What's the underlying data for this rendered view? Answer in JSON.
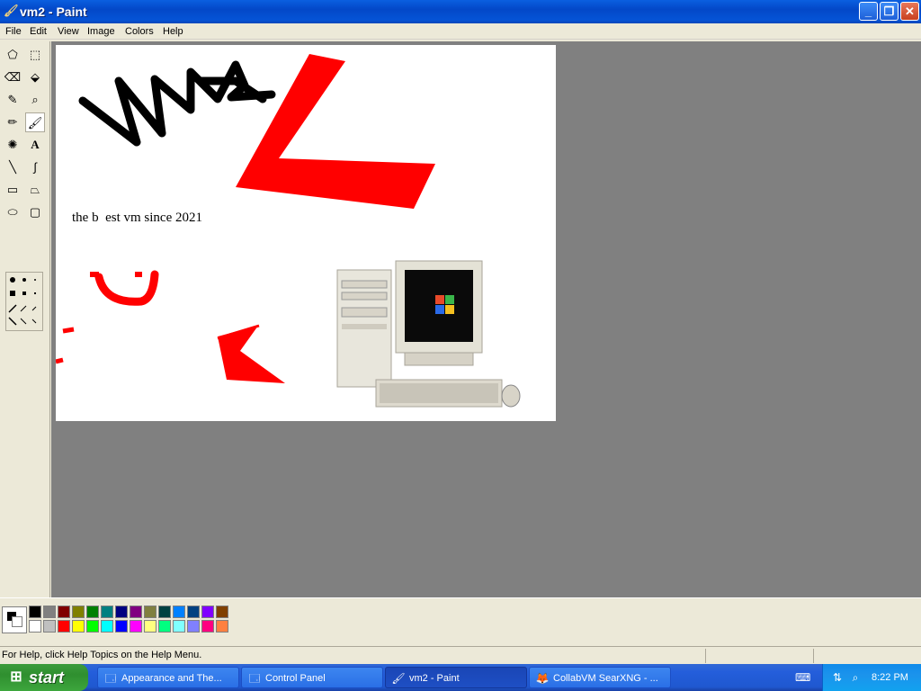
{
  "window": {
    "title": "vm2 - Paint",
    "minimize_glyph": "_",
    "maximize_glyph": "❐",
    "close_glyph": "✕"
  },
  "menu": {
    "items": [
      "File",
      "Edit",
      "View",
      "Image",
      "Colors",
      "Help"
    ]
  },
  "toolbox": {
    "tools": [
      {
        "name": "free-form-select-icon",
        "glyph": "⬠"
      },
      {
        "name": "rectangle-select-icon",
        "glyph": "⬚"
      },
      {
        "name": "eraser-icon",
        "glyph": "⌫"
      },
      {
        "name": "fill-bucket-icon",
        "glyph": "⬙"
      },
      {
        "name": "color-picker-icon",
        "glyph": "✎"
      },
      {
        "name": "magnifier-icon",
        "glyph": "⌕"
      },
      {
        "name": "pencil-icon",
        "glyph": "✏"
      },
      {
        "name": "brush-icon",
        "glyph": "🖌"
      },
      {
        "name": "airbrush-icon",
        "glyph": "✺"
      },
      {
        "name": "text-icon",
        "glyph": "A"
      },
      {
        "name": "line-icon",
        "glyph": "╲"
      },
      {
        "name": "curve-icon",
        "glyph": "∫"
      },
      {
        "name": "rectangle-icon",
        "glyph": "▭"
      },
      {
        "name": "polygon-icon",
        "glyph": "⏢"
      },
      {
        "name": "ellipse-icon",
        "glyph": "⬭"
      },
      {
        "name": "rounded-rectangle-icon",
        "glyph": "▢"
      }
    ],
    "selected_tool": "brush-icon"
  },
  "canvas": {
    "text": "the b  est vm since 2021",
    "drawing_text": "vma"
  },
  "palette": {
    "foreground": "#000000",
    "background": "#ffffff",
    "top_row": [
      "#000000",
      "#808080",
      "#800000",
      "#808000",
      "#008000",
      "#008080",
      "#000080",
      "#800080",
      "#808040",
      "#004040",
      "#0080ff",
      "#004080",
      "#8000ff",
      "#804000"
    ],
    "bottom_row": [
      "#ffffff",
      "#c0c0c0",
      "#ff0000",
      "#ffff00",
      "#00ff00",
      "#00ffff",
      "#0000ff",
      "#ff00ff",
      "#ffff80",
      "#00ff80",
      "#80ffff",
      "#8080ff",
      "#ff0080",
      "#ff8040"
    ]
  },
  "status": {
    "text": "For Help, click Help Topics on the Help Menu."
  },
  "taskbar": {
    "start_label": "start",
    "tasks": [
      {
        "label": "Appearance and The...",
        "icon": "🗔",
        "active": false
      },
      {
        "label": "Control Panel",
        "icon": "🗔",
        "active": false
      },
      {
        "label": "vm2 - Paint",
        "icon": "🖌",
        "active": true
      },
      {
        "label": "CollabVM SearXNG - ...",
        "icon": "🦊",
        "active": false
      }
    ],
    "clock": "8:22 PM"
  }
}
